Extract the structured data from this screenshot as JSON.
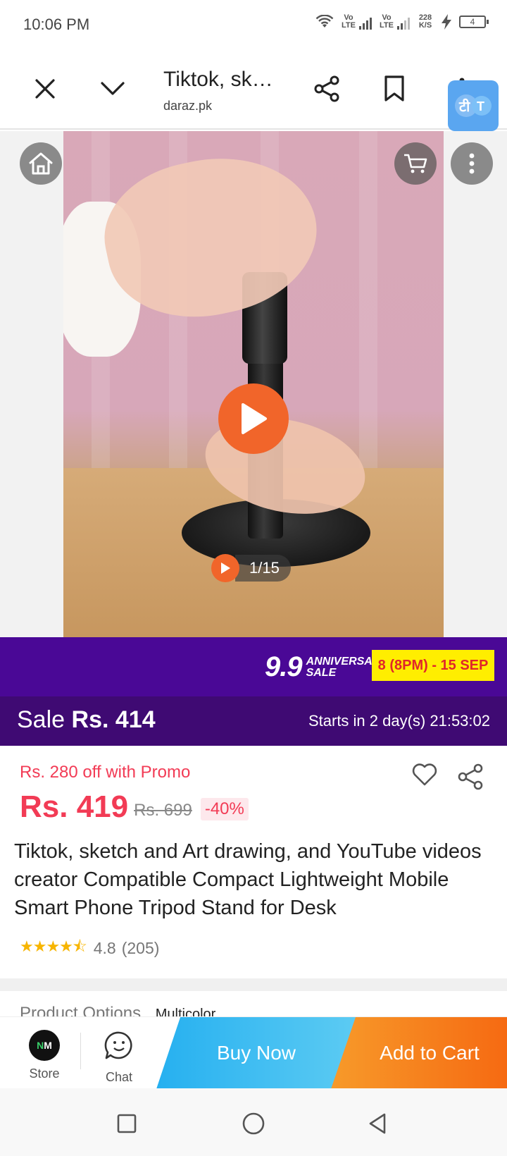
{
  "status_bar": {
    "time": "10:06 PM",
    "volte_1": "Vo LTE",
    "volte_2": "Vo LTE",
    "speed": "228 K/S",
    "battery": "4"
  },
  "toolbar": {
    "title": "Tiktok, sk…",
    "url": "daraz.pk",
    "translate_badge": "टी T"
  },
  "media": {
    "counter": "1/15"
  },
  "anniversary": {
    "big": "9.9",
    "sub_1": "ANNIVERSARY",
    "sub_2": "SALE",
    "dates": "8 (8PM) - 15 SEP"
  },
  "sale_bar": {
    "prefix": "Sale",
    "price": "Rs. 414",
    "countdown": "Starts in 2 day(s) 21:53:02"
  },
  "product": {
    "promo": "Rs. 280 off with Promo",
    "price": "Rs. 419",
    "old_price": "Rs. 699",
    "discount": "-40%",
    "title": "Tiktok, sketch and Art drawing, and YouTube videos creator Compatible Compact Lightweight Mobile Smart Phone Tripod Stand for Desk",
    "rating_value": "4.8",
    "rating_count": "(205)",
    "stars": 4.5,
    "options_label": "Product Options",
    "options_value": "Multicolor"
  },
  "action_bar": {
    "store_label": "Store",
    "store_logo_n": "N",
    "store_logo_m": "M",
    "chat_label": "Chat",
    "buy_now": "Buy Now",
    "add_to_cart": "Add to Cart"
  },
  "colors": {
    "brand_orange": "#f1652a",
    "price_red": "#f23b55",
    "banner_purple": "#4a0896",
    "sale_purple": "#3f0a73",
    "buy_blue": "#26b0f0",
    "cart_orange": "#f66a12"
  }
}
